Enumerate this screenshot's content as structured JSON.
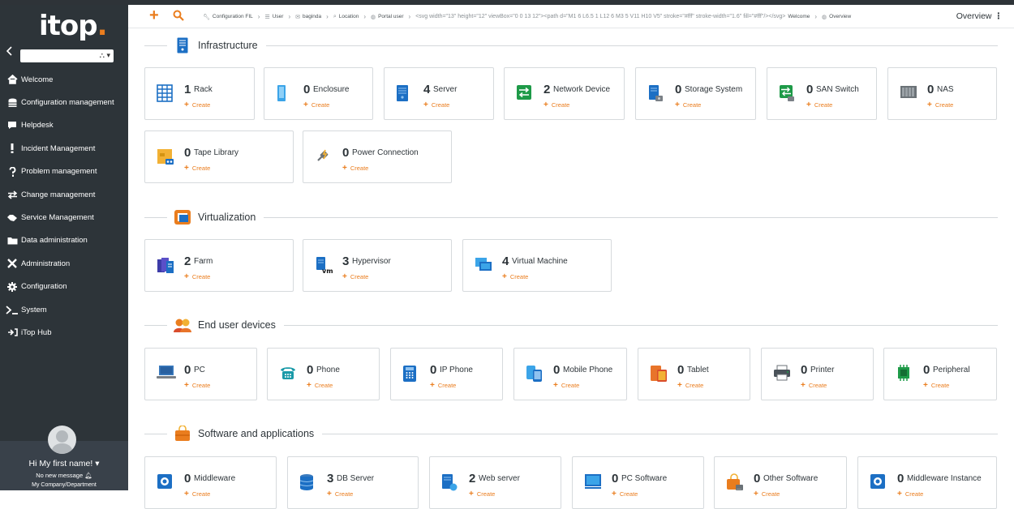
{
  "app": {
    "logo": "itop",
    "logo_dot": "."
  },
  "sidebar": {
    "org_select_placeholder": "",
    "items": [
      {
        "label": "Welcome",
        "icon": "home-icon"
      },
      {
        "label": "Configuration management",
        "icon": "database-icon"
      },
      {
        "label": "Helpdesk",
        "icon": "comment-icon"
      },
      {
        "label": "Incident Management",
        "icon": "exclamation-icon"
      },
      {
        "label": "Problem management",
        "icon": "question-icon"
      },
      {
        "label": "Change management",
        "icon": "exchange-icon"
      },
      {
        "label": "Service Management",
        "icon": "handshake-icon"
      },
      {
        "label": "Data administration",
        "icon": "folder-icon"
      },
      {
        "label": "Administration",
        "icon": "tools-icon"
      },
      {
        "label": "Configuration",
        "icon": "cog-icon"
      },
      {
        "label": "System",
        "icon": "terminal-icon"
      },
      {
        "label": "iTop Hub",
        "icon": "hub-icon"
      }
    ],
    "user": {
      "name": "Hi My first name!",
      "messages": "No new message",
      "org": "My Company/Department"
    }
  },
  "topbar": {
    "breadcrumb": [
      {
        "label": "Configuration FIL",
        "icon": "wrench-icon"
      },
      {
        "label": "User",
        "icon": "list-icon"
      },
      {
        "label": "baginda",
        "icon": "envelope-icon"
      },
      {
        "label": "Location",
        "icon": "search-icon"
      },
      {
        "label": "Portal user",
        "icon": "globe-icon"
      },
      {
        "label": "Welcome",
        "icon": "home-icon"
      },
      {
        "label": "Overview",
        "icon": "globe-icon"
      }
    ],
    "title": "Overview",
    "kebab": "⋮"
  },
  "create_label": "Create",
  "sections": [
    {
      "title": "Infrastructure",
      "icon": "server-rack-icon",
      "cards": [
        {
          "count": "1",
          "label": "Rack",
          "icon": "rack-icon"
        },
        {
          "count": "0",
          "label": "Enclosure",
          "icon": "enclosure-icon"
        },
        {
          "count": "4",
          "label": "Server",
          "icon": "server-icon"
        },
        {
          "count": "2",
          "label": "Network Device",
          "icon": "network-device-icon"
        },
        {
          "count": "0",
          "label": "Storage System",
          "icon": "storage-system-icon"
        },
        {
          "count": "0",
          "label": "SAN Switch",
          "icon": "san-switch-icon"
        },
        {
          "count": "0",
          "label": "NAS",
          "icon": "nas-icon"
        },
        {
          "count": "0",
          "label": "Tape Library",
          "icon": "tape-library-icon"
        },
        {
          "count": "0",
          "label": "Power Connection",
          "icon": "power-connection-icon"
        }
      ]
    },
    {
      "title": "Virtualization",
      "icon": "virtualization-icon",
      "cards": [
        {
          "count": "2",
          "label": "Farm",
          "icon": "farm-icon"
        },
        {
          "count": "3",
          "label": "Hypervisor",
          "icon": "hypervisor-icon"
        },
        {
          "count": "4",
          "label": "Virtual Machine",
          "icon": "virtual-machine-icon"
        }
      ]
    },
    {
      "title": "End user devices",
      "icon": "users-icon",
      "cards": [
        {
          "count": "0",
          "label": "PC",
          "icon": "pc-icon"
        },
        {
          "count": "0",
          "label": "Phone",
          "icon": "phone-icon"
        },
        {
          "count": "0",
          "label": "IP Phone",
          "icon": "ip-phone-icon"
        },
        {
          "count": "0",
          "label": "Mobile Phone",
          "icon": "mobile-phone-icon"
        },
        {
          "count": "0",
          "label": "Tablet",
          "icon": "tablet-icon"
        },
        {
          "count": "0",
          "label": "Printer",
          "icon": "printer-icon"
        },
        {
          "count": "0",
          "label": "Peripheral",
          "icon": "peripheral-icon"
        }
      ]
    },
    {
      "title": "Software and applications",
      "icon": "software-icon",
      "cards": [
        {
          "count": "0",
          "label": "Middleware",
          "icon": "middleware-icon"
        },
        {
          "count": "3",
          "label": "DB Server",
          "icon": "db-server-icon"
        },
        {
          "count": "2",
          "label": "Web server",
          "icon": "web-server-icon"
        },
        {
          "count": "0",
          "label": "PC Software",
          "icon": "pc-software-icon"
        },
        {
          "count": "0",
          "label": "Other Software",
          "icon": "other-software-icon"
        },
        {
          "count": "0",
          "label": "Middleware Instance",
          "icon": "middleware-instance-icon"
        }
      ]
    }
  ],
  "colors": {
    "sidebar_bg": "#2d3439",
    "accent": "#ea7d1e",
    "icon_blue": "#1c6fc4",
    "icon_green": "#1e9a48"
  }
}
